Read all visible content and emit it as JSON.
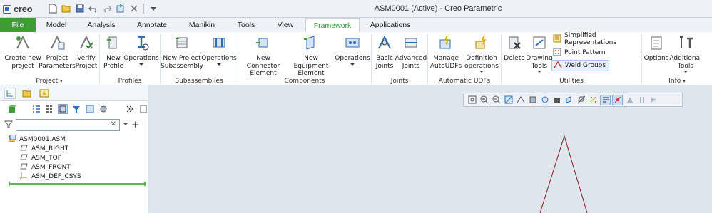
{
  "app": {
    "logo_text": "creo",
    "window_title": "ASM0001 (Active) - Creo Parametric"
  },
  "quick_access": [
    "new-icon",
    "open-icon",
    "save-icon",
    "undo-icon",
    "redo-icon",
    "regenerate-icon",
    "close-window-icon",
    "customize-icon"
  ],
  "tabs": [
    {
      "label": "File"
    },
    {
      "label": "Model"
    },
    {
      "label": "Analysis"
    },
    {
      "label": "Annotate"
    },
    {
      "label": "Manikin"
    },
    {
      "label": "Tools"
    },
    {
      "label": "View"
    },
    {
      "label": "Framework"
    },
    {
      "label": "Applications"
    }
  ],
  "active_tab": "Framework",
  "ribbon": {
    "project": {
      "label": "Project",
      "buttons": [
        "Create new\nproject",
        "Project\nParameters",
        "Verify\nProject"
      ]
    },
    "profiles": {
      "label": "Profiles",
      "buttons": [
        "New\nProfile",
        "Operations"
      ]
    },
    "subassemblies": {
      "label": "Subassemblies",
      "buttons": [
        "New Project\nSubassembly",
        "Operations"
      ]
    },
    "components": {
      "label": "Components",
      "buttons": [
        "New Connector\nElement",
        "New Equipment\nElement",
        "Operations"
      ]
    },
    "joints": {
      "label": "Joints",
      "buttons": [
        "Basic\nJoints",
        "Advanced\nJoints"
      ]
    },
    "autoudfs": {
      "label": "Automatic UDFs",
      "buttons": [
        "Manage\nAutoUDFs",
        "Definition\noperations"
      ]
    },
    "utilities": {
      "label": "Utilities",
      "buttons": [
        "Delete",
        "Drawing\nTools"
      ],
      "small": [
        "Simplified Representations",
        "Point Pattern",
        "Weld Groups"
      ]
    },
    "info": {
      "label": "Info",
      "buttons": [
        "Options",
        "Additional\nTools"
      ]
    }
  },
  "model_tree": {
    "search_value": "",
    "items": [
      {
        "label": "ASM0001.ASM",
        "icon": "assembly-icon"
      },
      {
        "label": "ASM_RIGHT",
        "icon": "datum-plane-icon"
      },
      {
        "label": "ASM_TOP",
        "icon": "datum-plane-icon"
      },
      {
        "label": "ASM_FRONT",
        "icon": "datum-plane-icon"
      },
      {
        "label": "ASM_DEF_CSYS",
        "icon": "csys-icon"
      }
    ]
  },
  "colors": {
    "file_tab": "#3f9b3a",
    "active_tab_text": "#2f8f2f",
    "graphics_bg": "#dfe5ec",
    "insert_line": "#5bb54f"
  }
}
